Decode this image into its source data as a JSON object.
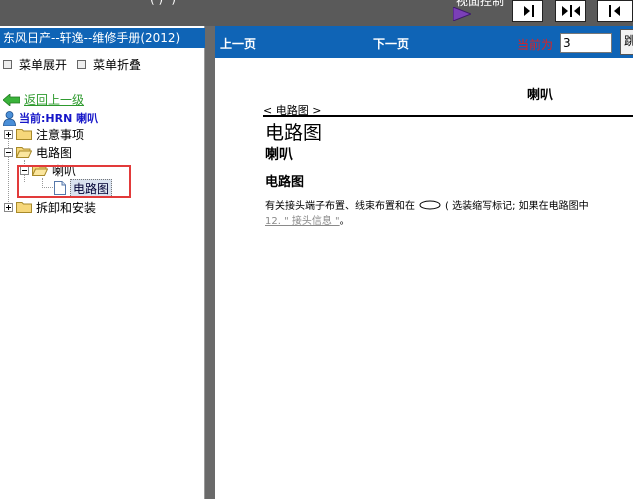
{
  "top": {
    "left_clip": "( )- )",
    "right_clip": "视面控制"
  },
  "left": {
    "manual_title": "东风日产--轩逸--维修手册(2012)",
    "expand_label": "菜单展开",
    "collapse_label": "菜单折叠",
    "back_label": "返回上一级",
    "current_label": "当前:HRN 喇叭",
    "tree": {
      "item1": "注意事项",
      "item2": "电路图",
      "item3": "喇叭",
      "item4": "电路图",
      "item5": "拆卸和安装"
    }
  },
  "nav": {
    "prev": "上一页",
    "next": "下一页",
    "current_label": "当前为",
    "page_value": "3",
    "go_label": "跳"
  },
  "doc": {
    "heading": "喇叭",
    "breadcrumb": "< 电路图 >",
    "title_big": "电路图",
    "title_mid": "喇叭",
    "title_sub": "电路图",
    "para_part1": "有关接头端子布置、线束布置和在",
    "para_part2": "( 选装缩写标记; 如果在电路图中",
    "para_link": "12. \" 接头信息 \"",
    "para_end": "。"
  },
  "colors": {
    "title_bar": "#0f64b6",
    "navbar": "#0f64b6",
    "highlight_box": "#e23a3a",
    "current_text": "#1515c8",
    "back_link": "#2e9a2e"
  }
}
